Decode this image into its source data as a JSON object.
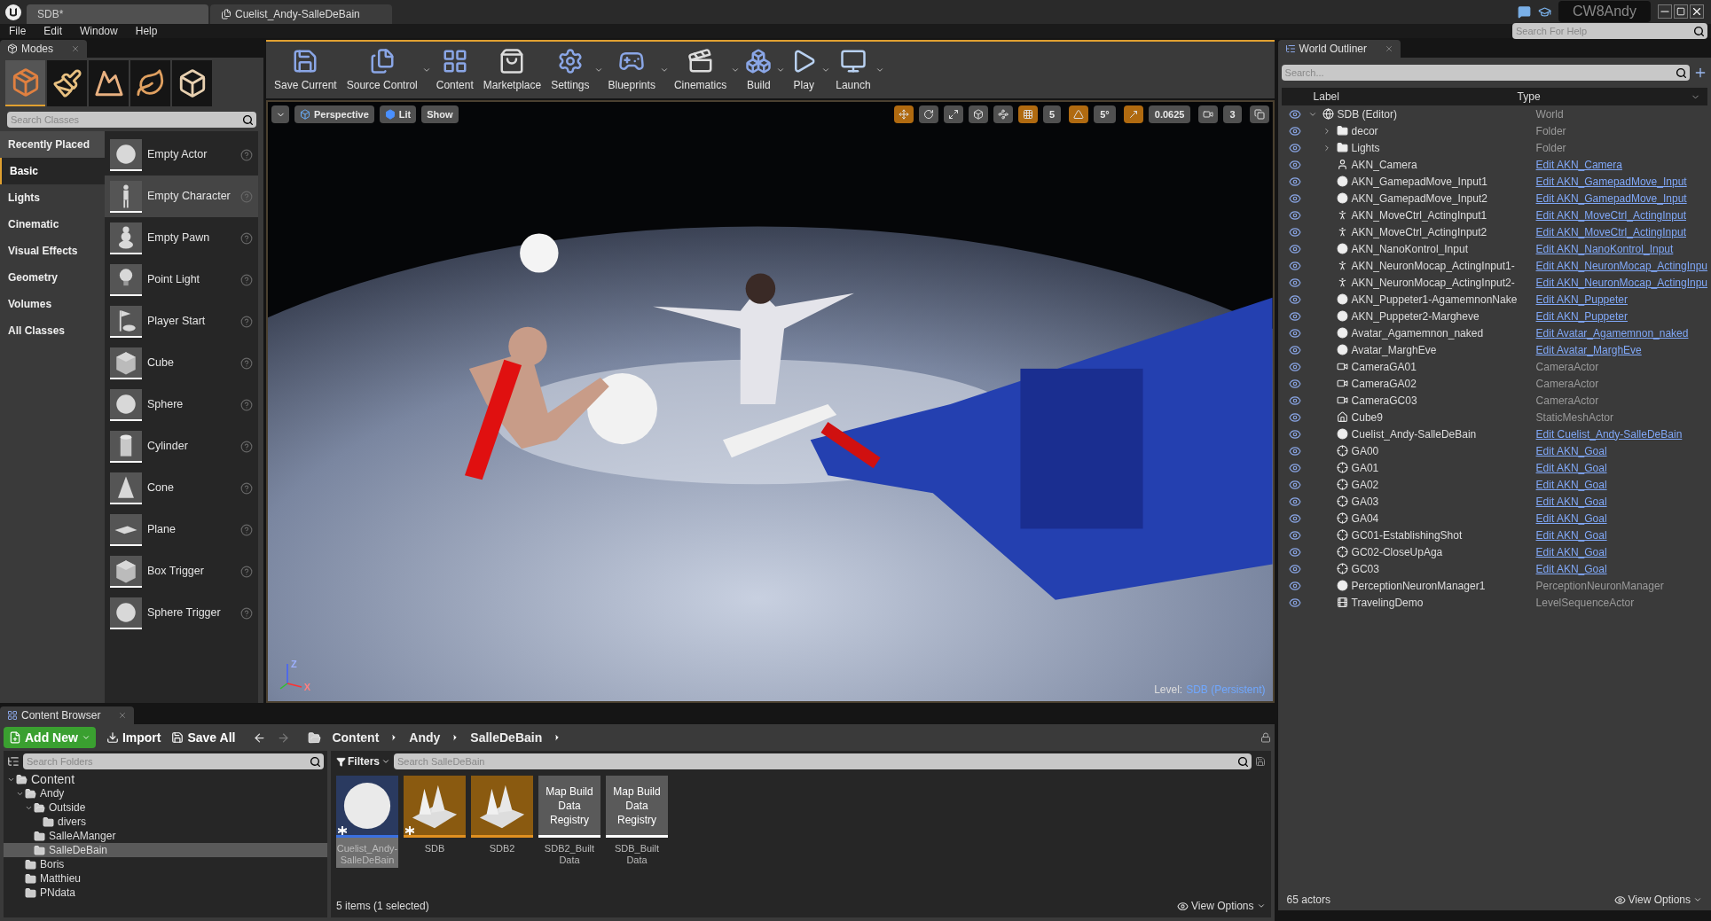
{
  "title_bar": {
    "tabs": [
      {
        "label": "SDB*",
        "selected": true
      },
      {
        "label": "Cuelist_Andy-SalleDeBain",
        "selected": false
      }
    ],
    "project": "CW8Andy",
    "help_search": {
      "placeholder": "Search For Help"
    }
  },
  "menu": [
    "File",
    "Edit",
    "Window",
    "Help"
  ],
  "modes": {
    "tab": "Modes",
    "tools": [
      {
        "kind": "place",
        "selected": true
      },
      {
        "kind": "paint",
        "selected": false
      },
      {
        "kind": "landscape",
        "selected": false
      },
      {
        "kind": "foliage",
        "selected": false
      },
      {
        "kind": "geometry",
        "selected": false
      }
    ],
    "search": {
      "placeholder": "Search Classes"
    },
    "categories": [
      {
        "label": "Recently Placed",
        "selected": false
      },
      {
        "label": "Basic",
        "selected": true
      },
      {
        "label": "Lights",
        "selected": false
      },
      {
        "label": "Cinematic",
        "selected": false
      },
      {
        "label": "Visual Effects",
        "selected": false
      },
      {
        "label": "Geometry",
        "selected": false
      },
      {
        "label": "Volumes",
        "selected": false
      },
      {
        "label": "All Classes",
        "selected": false
      }
    ],
    "items": [
      {
        "label": "Empty Actor",
        "kind": "sphere",
        "highlighted": false
      },
      {
        "label": "Empty Character",
        "kind": "figure",
        "highlighted": true
      },
      {
        "label": "Empty Pawn",
        "kind": "pawn",
        "highlighted": false
      },
      {
        "label": "Point Light",
        "kind": "bulb",
        "highlighted": false
      },
      {
        "label": "Player Start",
        "kind": "flag",
        "highlighted": false
      },
      {
        "label": "Cube",
        "kind": "cube",
        "highlighted": false
      },
      {
        "label": "Sphere",
        "kind": "sphere",
        "highlighted": false
      },
      {
        "label": "Cylinder",
        "kind": "cylinder",
        "highlighted": false
      },
      {
        "label": "Cone",
        "kind": "cone",
        "highlighted": false
      },
      {
        "label": "Plane",
        "kind": "plane",
        "highlighted": false
      },
      {
        "label": "Box Trigger",
        "kind": "cube",
        "highlighted": false
      },
      {
        "label": "Sphere Trigger",
        "kind": "sphere",
        "highlighted": false
      }
    ]
  },
  "toolbar": [
    {
      "label": "Save Current",
      "kind": "save",
      "dropdown": false
    },
    {
      "label": "Source Control",
      "kind": "source",
      "dropdown": true
    },
    {
      "label": "Content",
      "kind": "content",
      "dropdown": false
    },
    {
      "label": "Marketplace",
      "kind": "market",
      "dropdown": false
    },
    {
      "label": "Settings",
      "kind": "settings",
      "dropdown": true
    },
    {
      "label": "Blueprints",
      "kind": "blueprints",
      "dropdown": true
    },
    {
      "label": "Cinematics",
      "kind": "cinematics",
      "dropdown": true
    },
    {
      "label": "Build",
      "kind": "build",
      "dropdown": true
    },
    {
      "label": "Play",
      "kind": "play",
      "dropdown": true
    },
    {
      "label": "Launch",
      "kind": "launch",
      "dropdown": true
    }
  ],
  "viewport": {
    "buttons": [
      {
        "label": "Perspective",
        "kind": "view"
      },
      {
        "label": "Lit",
        "kind": "lit"
      },
      {
        "label": "Show",
        "kind": "plain"
      }
    ],
    "controls": [
      {
        "kind": "toggle",
        "on": true
      },
      {
        "kind": "toggle",
        "on": false
      },
      {
        "kind": "toggle",
        "on": false
      },
      {
        "kind": "toggle",
        "on": false
      },
      {
        "kind": "toggle",
        "on": false
      },
      {
        "kind": "toggle",
        "on": true
      },
      {
        "kind": "value",
        "text": "5"
      },
      {
        "kind": "toggle",
        "on": true
      },
      {
        "kind": "value",
        "text": "5°"
      },
      {
        "kind": "toggle",
        "on": true
      },
      {
        "kind": "value",
        "text": "0.0625"
      },
      {
        "kind": "toggle",
        "on": false
      },
      {
        "kind": "value",
        "text": "3"
      },
      {
        "kind": "toggle",
        "on": false
      }
    ],
    "gizmo": [
      "Z",
      "X"
    ],
    "level": {
      "label": "Level:",
      "value": "SDB (Persistent)"
    }
  },
  "outliner": {
    "tab": "World Outliner",
    "search": {
      "placeholder": "Search..."
    },
    "columns": [
      "Label",
      "Type"
    ],
    "rows": [
      {
        "label": "SDB (Editor)",
        "type": "World",
        "link": false,
        "kind": "world",
        "expanded": true,
        "children": [
          {
            "label": "decor",
            "type": "Folder",
            "link": false,
            "kind": "folder",
            "expanded": false
          },
          {
            "label": "Lights",
            "type": "Folder",
            "link": false,
            "kind": "folder",
            "expanded": false
          },
          {
            "label": "AKN_Camera",
            "type": "Edit AKN_Camera",
            "link": true,
            "kind": "pawn"
          },
          {
            "label": "AKN_GamepadMove_Input1",
            "type": "Edit AKN_GamepadMove_Input",
            "link": true,
            "kind": "actor"
          },
          {
            "label": "AKN_GamepadMove_Input2",
            "type": "Edit AKN_GamepadMove_Input",
            "link": true,
            "kind": "actor"
          },
          {
            "label": "AKN_MoveCtrl_ActingInput1",
            "type": "Edit AKN_MoveCtrl_ActingInput",
            "link": true,
            "kind": "character"
          },
          {
            "label": "AKN_MoveCtrl_ActingInput2",
            "type": "Edit AKN_MoveCtrl_ActingInput",
            "link": true,
            "kind": "character"
          },
          {
            "label": "AKN_NanoKontrol_Input",
            "type": "Edit AKN_NanoKontrol_Input",
            "link": true,
            "kind": "actor"
          },
          {
            "label": "AKN_NeuronMocap_ActingInput1-",
            "type": "Edit AKN_NeuronMocap_ActingInpu",
            "link": true,
            "kind": "character"
          },
          {
            "label": "AKN_NeuronMocap_ActingInput2-",
            "type": "Edit AKN_NeuronMocap_ActingInpu",
            "link": true,
            "kind": "character"
          },
          {
            "label": "AKN_Puppeter1-AgamemnonNake",
            "type": "Edit AKN_Puppeter",
            "link": true,
            "kind": "actor"
          },
          {
            "label": "AKN_Puppeter2-Margheve",
            "type": "Edit AKN_Puppeter",
            "link": true,
            "kind": "actor"
          },
          {
            "label": "Avatar_Agamemnon_naked",
            "type": "Edit Avatar_Agamemnon_naked",
            "link": true,
            "kind": "actor"
          },
          {
            "label": "Avatar_MarghEve",
            "type": "Edit Avatar_MarghEve",
            "link": true,
            "kind": "actor"
          },
          {
            "label": "CameraGA01",
            "type": "CameraActor",
            "link": false,
            "kind": "camera"
          },
          {
            "label": "CameraGA02",
            "type": "CameraActor",
            "link": false,
            "kind": "camera"
          },
          {
            "label": "CameraGC03",
            "type": "CameraActor",
            "link": false,
            "kind": "camera"
          },
          {
            "label": "Cube9",
            "type": "StaticMeshActor",
            "link": false,
            "kind": "mesh"
          },
          {
            "label": "Cuelist_Andy-SalleDeBain",
            "type": "Edit Cuelist_Andy-SalleDeBain",
            "link": true,
            "kind": "actor"
          },
          {
            "label": "GA00",
            "type": "Edit AKN_Goal",
            "link": true,
            "kind": "goal"
          },
          {
            "label": "GA01",
            "type": "Edit AKN_Goal",
            "link": true,
            "kind": "goal"
          },
          {
            "label": "GA02",
            "type": "Edit AKN_Goal",
            "link": true,
            "kind": "goal"
          },
          {
            "label": "GA03",
            "type": "Edit AKN_Goal",
            "link": true,
            "kind": "goal"
          },
          {
            "label": "GA04",
            "type": "Edit AKN_Goal",
            "link": true,
            "kind": "goal"
          },
          {
            "label": "GC01-EstablishingShot",
            "type": "Edit AKN_Goal",
            "link": true,
            "kind": "goal"
          },
          {
            "label": "GC02-CloseUpAga",
            "type": "Edit AKN_Goal",
            "link": true,
            "kind": "goal"
          },
          {
            "label": "GC03",
            "type": "Edit AKN_Goal",
            "link": true,
            "kind": "goal"
          },
          {
            "label": "PerceptionNeuronManager1",
            "type": "PerceptionNeuronManager",
            "link": false,
            "kind": "actor"
          },
          {
            "label": "TravelingDemo",
            "type": "LevelSequenceActor",
            "link": false,
            "kind": "sequence"
          }
        ]
      }
    ],
    "count": "65 actors",
    "view_options": "View Options"
  },
  "content_browser": {
    "tab": "Content Browser",
    "add_new": "Add New",
    "import": "Import",
    "save_all": "Save All",
    "path": [
      "Content",
      "Andy",
      "SalleDeBain"
    ],
    "folder_search": {
      "placeholder": "Search Folders"
    },
    "filters": "Filters",
    "asset_search": {
      "placeholder": "Search SalleDeBain"
    },
    "folders": [
      {
        "label": "Content",
        "expanded": true,
        "selected": false,
        "children": [
          {
            "label": "Andy",
            "expanded": true,
            "selected": false,
            "children": [
              {
                "label": "Outside",
                "expanded": true,
                "selected": false,
                "children": [
                  {
                    "label": "divers",
                    "selected": false
                  }
                ]
              },
              {
                "label": "SalleAManger",
                "selected": false
              },
              {
                "label": "SalleDeBain",
                "selected": true
              }
            ]
          },
          {
            "label": "Boris",
            "selected": false
          },
          {
            "label": "Matthieu",
            "selected": false
          },
          {
            "label": "PNdata",
            "selected": false
          }
        ]
      }
    ],
    "assets": [
      {
        "label": "Cuelist_Andy-SalleDeBain",
        "kind": "sphere",
        "selected": true,
        "modified": true
      },
      {
        "label": "SDB",
        "kind": "level",
        "selected": false,
        "modified": true
      },
      {
        "label": "SDB2",
        "kind": "level",
        "selected": false,
        "modified": false
      },
      {
        "label": "SDB2_Built Data",
        "kind": "registry",
        "thumb_text": "Map Build Data Registry",
        "selected": false,
        "modified": false
      },
      {
        "label": "SDB_Built Data",
        "kind": "registry",
        "thumb_text": "Map Build Data Registry",
        "selected": false,
        "modified": false
      }
    ],
    "status": "5 items (1 selected)",
    "view_options": "View Options"
  }
}
